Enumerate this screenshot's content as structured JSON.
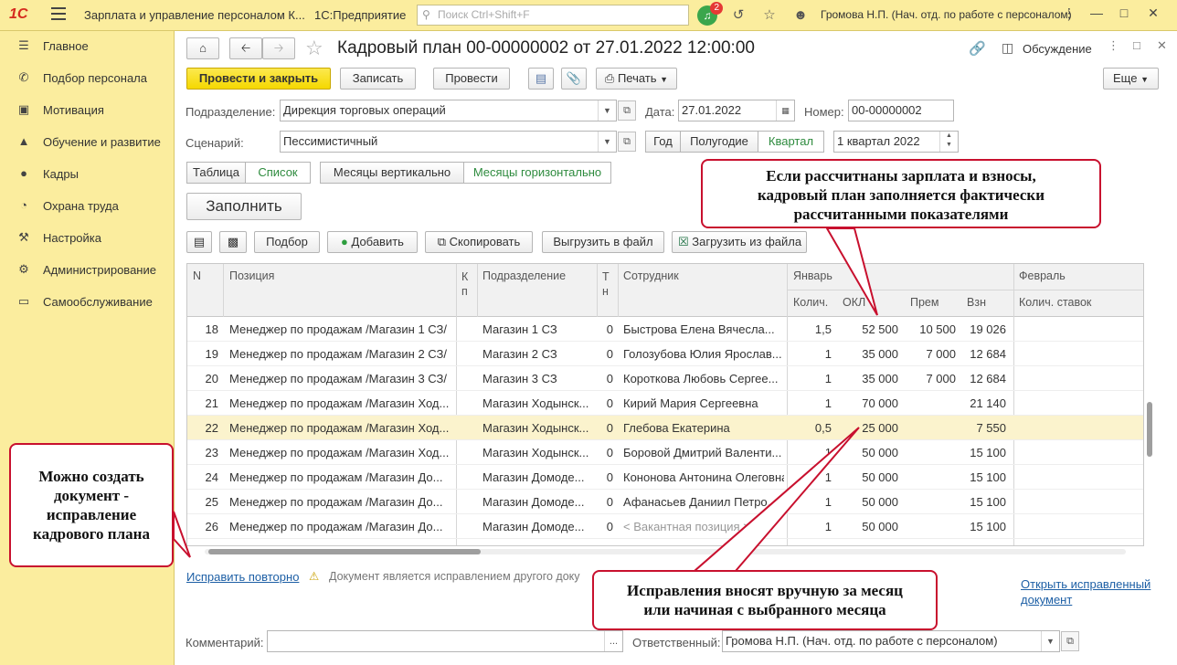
{
  "titlebar": {
    "logo": "1С",
    "app_title": "Зарплата и управление персоналом К...",
    "platform": "1С:Предприятие",
    "search_placeholder": "Поиск Ctrl+Shift+F",
    "notifications_count": "2",
    "user": "Громова Н.П. (Нач. отд. по работе с персоналом)"
  },
  "sidebar": {
    "items": [
      {
        "label": "Главное",
        "icon": "menu-lines-icon"
      },
      {
        "label": "Подбор персонала",
        "icon": "phone-icon"
      },
      {
        "label": "Мотивация",
        "icon": "gift-icon"
      },
      {
        "label": "Обучение и развитие",
        "icon": "graduation-cap-icon"
      },
      {
        "label": "Кадры",
        "icon": "people-icon"
      },
      {
        "label": "Охрана труда",
        "icon": "helmet-icon"
      },
      {
        "label": "Настройка",
        "icon": "wrench-icon"
      },
      {
        "label": "Администрирование",
        "icon": "gear-icon"
      },
      {
        "label": "Самообслуживание",
        "icon": "monitor-icon"
      }
    ]
  },
  "document": {
    "title": "Кадровый план 00-00000002 от 27.01.2022 12:00:00",
    "discussion": "Обсуждение",
    "buttons": {
      "post_close": "Провести и закрыть",
      "save": "Записать",
      "post": "Провести",
      "print": "Печать",
      "more": "Еще"
    },
    "labels": {
      "department": "Подразделение:",
      "date": "Дата:",
      "number": "Номер:",
      "scenario": "Сценарий:",
      "comment": "Комментарий:",
      "responsible": "Ответственный:"
    },
    "values": {
      "department": "Дирекция торговых операций",
      "date": "27.01.2022",
      "number": "00-00000002",
      "scenario": "Пессимистичный",
      "period": "1 квартал 2022",
      "responsible": "Громова Н.П. (Нач. отд. по работе с персоналом)"
    },
    "period_seg": [
      "Год",
      "Полугодие",
      "Квартал"
    ],
    "view_seg": [
      "Таблица",
      "Список"
    ],
    "months_seg": [
      "Месяцы вертикально",
      "Месяцы горизонтально"
    ],
    "fill_button": "Заполнить",
    "table_toolbar": {
      "select": "Подбор",
      "add": "Добавить",
      "copy": "Скопировать",
      "export": "Выгрузить в файл",
      "import": "Загрузить из файла"
    }
  },
  "table": {
    "headers": {
      "n": "N",
      "position": "Позиция",
      "kp": "К п",
      "department": "Подразделение",
      "tn": "Т н",
      "employee": "Сотрудник",
      "january": "Январь",
      "february": "Февраль",
      "qty": "Колич.",
      "okl": "ОКЛ",
      "prem": "Прем",
      "vzn": "Взн",
      "qty_rates": "Колич. ставок"
    },
    "rows": [
      {
        "n": "18",
        "position": "Менеджер по продажам /Магазин 1 СЗ/",
        "department": "Магазин 1 СЗ",
        "tn": "0",
        "employee": "Быстрова Елена Вячесла...",
        "qty": "1,5",
        "okl": "52 500",
        "prem": "10 500",
        "vzn": "19 026"
      },
      {
        "n": "19",
        "position": "Менеджер по продажам /Магазин 2 СЗ/",
        "department": "Магазин 2 СЗ",
        "tn": "0",
        "employee": "Голозубова Юлия Ярослав...",
        "qty": "1",
        "okl": "35 000",
        "prem": "7 000",
        "vzn": "12 684"
      },
      {
        "n": "20",
        "position": "Менеджер по продажам /Магазин 3 СЗ/",
        "department": "Магазин 3 СЗ",
        "tn": "0",
        "employee": "Короткова Любовь Сергее...",
        "qty": "1",
        "okl": "35 000",
        "prem": "7 000",
        "vzn": "12 684"
      },
      {
        "n": "21",
        "position": "Менеджер по продажам /Магазин Ход...",
        "department": "Магазин Ходынск...",
        "tn": "0",
        "employee": "Кирий Мария Сергеевна",
        "qty": "1",
        "okl": "70 000",
        "prem": "",
        "vzn": "21 140"
      },
      {
        "n": "22",
        "position": "Менеджер по продажам /Магазин Ход...",
        "department": "Магазин Ходынск...",
        "tn": "0",
        "employee": "Глебова Екатерина",
        "qty": "0,5",
        "okl": "25 000",
        "prem": "",
        "vzn": "7 550"
      },
      {
        "n": "23",
        "position": "Менеджер по продажам /Магазин Ход...",
        "department": "Магазин Ходынск...",
        "tn": "0",
        "employee": "Боровой Дмитрий Валенти...",
        "qty": "1",
        "okl": "50 000",
        "prem": "",
        "vzn": "15 100"
      },
      {
        "n": "24",
        "position": "Менеджер по продажам /Магазин До...",
        "department": "Магазин Домоде...",
        "tn": "0",
        "employee": "Кононова Антонина Олеговна",
        "qty": "1",
        "okl": "50 000",
        "prem": "",
        "vzn": "15 100"
      },
      {
        "n": "25",
        "position": "Менеджер по продажам /Магазин До...",
        "department": "Магазин Домоде...",
        "tn": "0",
        "employee": "Афанасьев Даниил Петро...",
        "qty": "1",
        "okl": "50 000",
        "prem": "",
        "vzn": "15 100"
      },
      {
        "n": "26",
        "position": "Менеджер по продажам /Магазин До...",
        "department": "Магазин Домоде...",
        "tn": "0",
        "employee": "< Вакантная позиция >",
        "qty": "1",
        "okl": "50 000",
        "prem": "",
        "vzn": "15 100"
      }
    ]
  },
  "footer": {
    "fix_again": "Исправить повторно",
    "warning": "Документ является исправлением другого доку",
    "open_fixed_1": "Открыть исправленный",
    "open_fixed_2": "документ"
  },
  "callouts": {
    "top": [
      "Если рассчитнаны зарплата и взносы,",
      "кадровый план заполняется фактически",
      "рассчитанными показателями"
    ],
    "left": [
      "Можно создать",
      "документ -",
      "исправление",
      "кадрового плана"
    ],
    "bottom": [
      "Исправления вносят вручную за месяц",
      "или начиная с выбранного месяца"
    ]
  },
  "colors": {
    "accent_yellow": "#fbed9e",
    "primary_button": "#f5d800",
    "selected_row": "#fbf3cd",
    "callout_border": "#c8102e",
    "link": "#1d5fa5",
    "active_green": "#2e8b3e"
  }
}
